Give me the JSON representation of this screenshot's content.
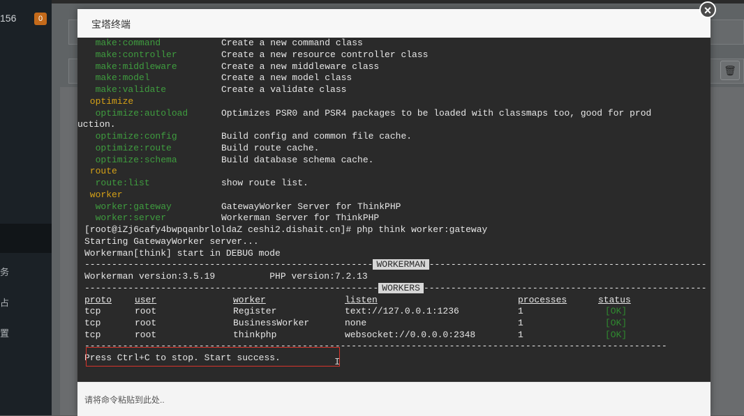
{
  "sidebar": {
    "server_ip_fragment": "156",
    "badge": "0",
    "nav": [
      {
        "label": "务"
      },
      {
        "label": "占"
      },
      {
        "label": "置"
      }
    ]
  },
  "modal": {
    "title": "宝塔终端",
    "close": "×",
    "input_placeholder": "请将命令粘贴到此处.."
  },
  "terminal": {
    "commands": [
      {
        "cmd": "  make:command",
        "desc": "Create a new command class"
      },
      {
        "cmd": "  make:controller",
        "desc": "Create a new resource controller class"
      },
      {
        "cmd": "  make:middleware",
        "desc": "Create a new middleware class"
      },
      {
        "cmd": "  make:model",
        "desc": "Create a new model class"
      },
      {
        "cmd": "  make:validate",
        "desc": "Create a validate class"
      }
    ],
    "group_optimize": " optimize",
    "optimize_autoload_cmd": "  optimize:autoload",
    "optimize_autoload_desc": "Optimizes PSR0 and PSR4 packages to be loaded with classmaps too, good for prod",
    "optimize_autoload_wrap": "uction.",
    "optimize_cmds": [
      {
        "cmd": "  optimize:config",
        "desc": "Build config and common file cache."
      },
      {
        "cmd": "  optimize:route",
        "desc": "Build route cache."
      },
      {
        "cmd": "  optimize:schema",
        "desc": "Build database schema cache."
      }
    ],
    "group_route": " route",
    "route_list_cmd": "  route:list",
    "route_list_desc": "show route list.",
    "group_worker": " worker",
    "worker_cmds": [
      {
        "cmd": "  worker:gateway",
        "desc": "GatewayWorker Server for ThinkPHP"
      },
      {
        "cmd": "  worker:server",
        "desc": "Workerman Server for ThinkPHP"
      }
    ],
    "prompt_line": "[root@iZj6cafy4bwpqanbrloldaZ ceshi2.dishait.cn]# php think worker:gateway",
    "starting": "Starting GatewayWorker server...",
    "debug_mode": "Workerman[think] start in DEBUG mode",
    "dash_left_1": "-----------------------------------------------------",
    "workerman_label": "WORKERMAN",
    "dash_right_1": "---------------------------------------------------",
    "version_line": "Workerman version:3.5.19          PHP version:7.2.13",
    "dash_left_2": "------------------------------------------------------",
    "workers_label": "WORKERS",
    "dash_right_2": "----------------------------------------------------",
    "table_headers": [
      "proto",
      "user",
      "worker",
      "listen",
      "processes",
      "status"
    ],
    "rows": [
      [
        "tcp",
        "root",
        "Register",
        "text://127.0.0.1:1236",
        "1",
        "[OK]"
      ],
      [
        "tcp",
        "root",
        "BusinessWorker",
        "none",
        "1",
        "[OK]"
      ],
      [
        "tcp",
        "root",
        "thinkphp",
        "websocket://0.0.0.0:2348",
        "1",
        "[OK]"
      ]
    ],
    "dash_full": "-----------------------------------------------------------------------------------------------------------",
    "final_line": "Press Ctrl+C to stop. Start success."
  }
}
